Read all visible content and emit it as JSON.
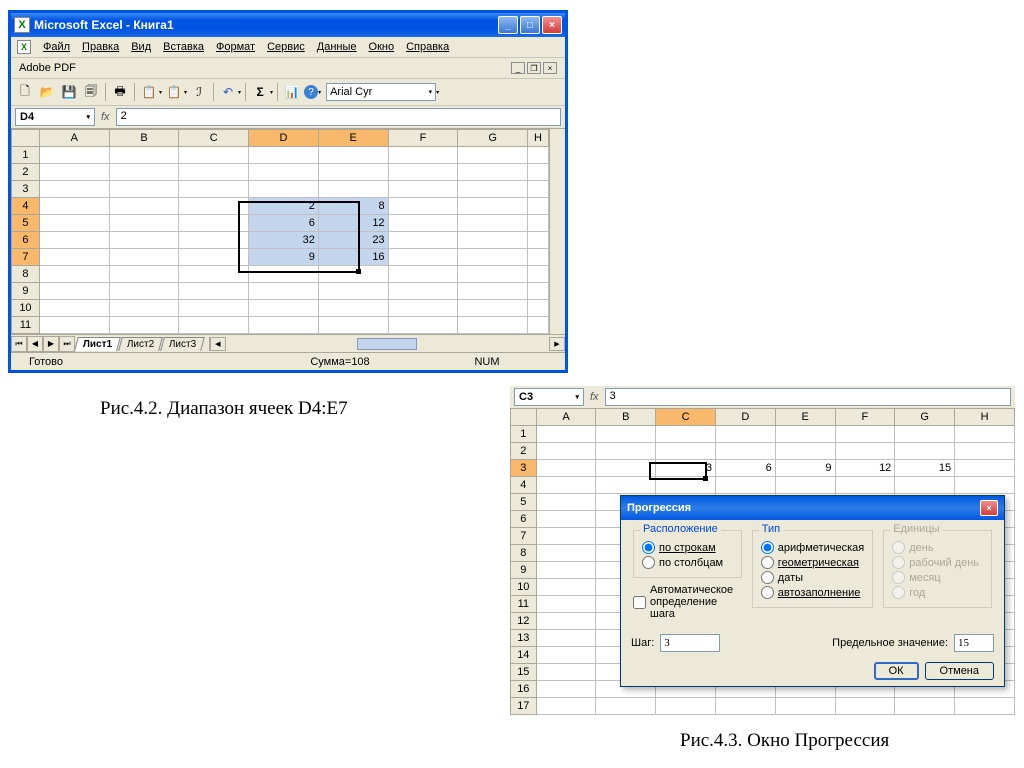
{
  "fig1": {
    "titlebar_text": "Microsoft Excel - Книга1",
    "menus": [
      "Файл",
      "Правка",
      "Вид",
      "Вставка",
      "Формат",
      "Сервис",
      "Данные",
      "Окно",
      "Справка"
    ],
    "pdfbar": "Adobe PDF",
    "font": "Arial Cyr",
    "namebox": "D4",
    "formula": "2",
    "cols": [
      "A",
      "B",
      "C",
      "D",
      "E",
      "F",
      "G",
      "H"
    ],
    "rows": [
      "1",
      "2",
      "3",
      "4",
      "5",
      "6",
      "7",
      "8",
      "9",
      "10",
      "11"
    ],
    "cells": {
      "D4": "2",
      "E4": "8",
      "D5": "6",
      "E5": "12",
      "D6": "32",
      "E6": "23",
      "D7": "9",
      "E7": "16"
    },
    "sheets": [
      "Лист1",
      "Лист2",
      "Лист3"
    ],
    "status_ready": "Готово",
    "status_sum": "Сумма=108",
    "status_num": "NUM"
  },
  "caption1": "Рис.4.2. Диапазон ячеек D4:E7",
  "fig2": {
    "namebox": "C3",
    "formula": "3",
    "cols": [
      "A",
      "B",
      "C",
      "D",
      "E",
      "F",
      "G",
      "H"
    ],
    "rows": [
      "1",
      "2",
      "3",
      "4",
      "5",
      "6",
      "7",
      "8",
      "9",
      "10",
      "11",
      "12",
      "13",
      "14",
      "15",
      "16",
      "17"
    ],
    "cells": {
      "C3": "3",
      "D3": "6",
      "E3": "9",
      "F3": "12",
      "G3": "15"
    }
  },
  "dialog": {
    "title": "Прогрессия",
    "grp_location": "Расположение",
    "opt_rows": "по строкам",
    "opt_cols": "по столбцам",
    "chk_auto": "Автоматическое определение шага",
    "grp_type": "Тип",
    "opt_arith": "арифметическая",
    "opt_geom": "геометрическая",
    "opt_dates": "даты",
    "opt_autofill": "автозаполнение",
    "grp_units": "Единицы",
    "opt_day": "день",
    "opt_workday": "рабочий день",
    "opt_month": "месяц",
    "opt_year": "год",
    "lbl_step": "Шаг:",
    "val_step": "3",
    "lbl_limit": "Предельное значение:",
    "val_limit": "15",
    "btn_ok": "ОК",
    "btn_cancel": "Отмена"
  },
  "caption2": "Рис.4.3. Окно Прогрессия"
}
